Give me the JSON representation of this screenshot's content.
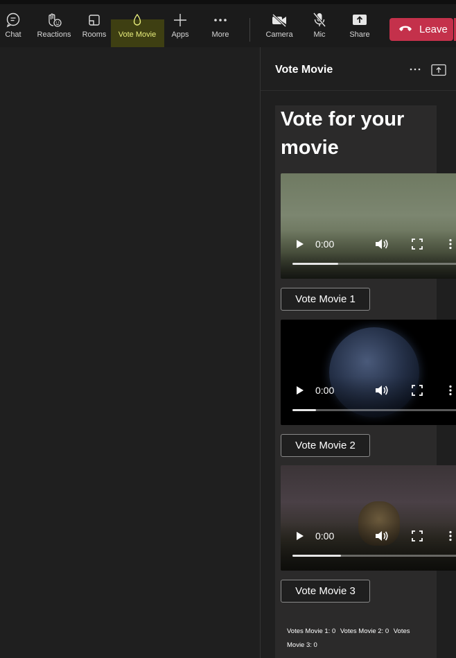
{
  "toolbar": {
    "items": [
      {
        "label": "Chat",
        "icon": "chat-icon"
      },
      {
        "label": "Reactions",
        "icon": "reactions-icon"
      },
      {
        "label": "Rooms",
        "icon": "rooms-icon"
      },
      {
        "label": "Vote Movie",
        "icon": "vote-movie-icon",
        "active": true
      },
      {
        "label": "Apps",
        "icon": "plus-icon"
      },
      {
        "label": "More",
        "icon": "more-icon"
      },
      {
        "label": "Camera",
        "icon": "camera-off-icon"
      },
      {
        "label": "Mic",
        "icon": "mic-off-icon"
      },
      {
        "label": "Share",
        "icon": "share-icon"
      }
    ],
    "leave_label": "Leave",
    "colors": {
      "active": "#e9ef7c",
      "leave": "#c4314b"
    }
  },
  "panel": {
    "title": "Vote Movie",
    "heading": "Vote for your movie",
    "videos": [
      {
        "time": "0:00",
        "progress": 0.27,
        "vote_label": "Vote Movie 1"
      },
      {
        "time": "0:00",
        "progress": 0.14,
        "vote_label": "Vote Movie 2"
      },
      {
        "time": "0:00",
        "progress": 0.29,
        "vote_label": "Vote Movie 3"
      }
    ],
    "votes": [
      "Votes Movie 1: 0",
      "Votes Movie 2: 0",
      "Votes Movie 3: 0"
    ]
  }
}
